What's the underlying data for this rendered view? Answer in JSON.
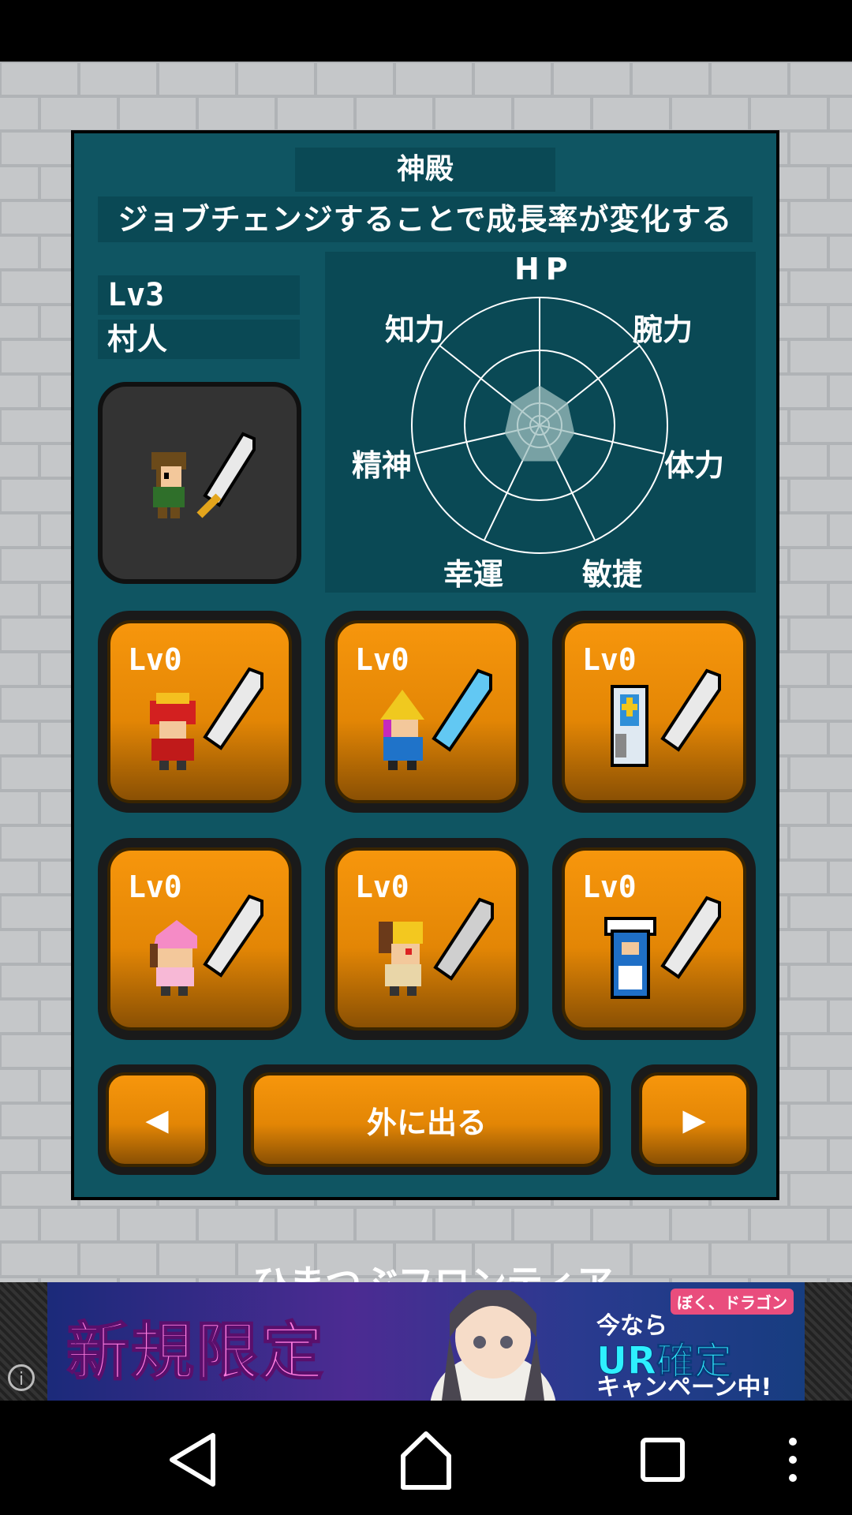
{
  "screen": {
    "title": "神殿",
    "subtitle": "ジョブチェンジすることで成長率が変化する"
  },
  "character": {
    "level": "Lv3",
    "job": "村人"
  },
  "radar": {
    "labels": {
      "hp": "HP",
      "strength": "腕力",
      "stamina": "体力",
      "agility": "敏捷",
      "luck": "幸運",
      "spirit": "精神",
      "intelligence": "知力"
    },
    "values": [
      0.2,
      0.18,
      0.18,
      0.2,
      0.2,
      0.18,
      0.18
    ]
  },
  "jobs": [
    {
      "level": "Lv0",
      "icon": "red-warrior-icon"
    },
    {
      "level": "Lv0",
      "icon": "black-mage-icon"
    },
    {
      "level": "Lv0",
      "icon": "priest-icon"
    },
    {
      "level": "Lv0",
      "icon": "pink-girl-icon"
    },
    {
      "level": "Lv0",
      "icon": "blonde-fighter-icon"
    },
    {
      "level": "Lv0",
      "icon": "blue-knight-icon"
    }
  ],
  "buttons": {
    "prev": "◀",
    "exit": "外に出る",
    "next": "▶"
  },
  "footer": {
    "brand": "ひまつぶフロンティア"
  },
  "ad": {
    "headline": "新規限定",
    "badge": "ぼく、ドラゴン",
    "line1": "今なら",
    "line2": "UR確定",
    "line3": "キャンペーン中!",
    "info_icon": "info-icon"
  },
  "colors": {
    "panel": "#0f5562",
    "panel_dark": "#0a4955",
    "button_orange": "#f7960c",
    "brick": "#a8abae"
  }
}
